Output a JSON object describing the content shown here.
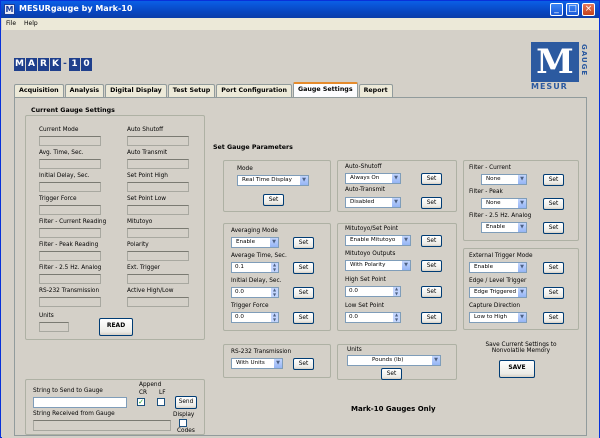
{
  "window": {
    "title": "MESURgauge by Mark-10",
    "icon": "M",
    "min": "_",
    "max": "□",
    "close": "×"
  },
  "menu": [
    "File",
    "Help"
  ],
  "logo": {
    "letters": [
      "M",
      "A",
      "R",
      "K",
      "-",
      "1",
      "0"
    ],
    "mesur_letter": "M",
    "mesur_text": "MESUR",
    "gauge_text": "GAUGE"
  },
  "tabs": [
    "Acquisition",
    "Analysis",
    "Digital Display",
    "Test Setup",
    "Port Configuration",
    "Gauge Settings",
    "Report"
  ],
  "current": {
    "title": "Current Gauge Settings",
    "left_labels": [
      "Current Mode",
      "Avg. Time, Sec.",
      "Initial Delay, Sec.",
      "Trigger Force",
      "Filter - Current Reading",
      "Filter - Peak Reading",
      "Filter - 2.5 Hz. Analog",
      "RS-232 Transmission",
      "Units"
    ],
    "right_labels": [
      "Auto Shutoff",
      "Auto Transmit",
      "Set Point High",
      "Set Point Low",
      "Mitutoyo",
      "Polarity",
      "Ext. Trigger",
      "Active High/Low"
    ],
    "read_button": "READ"
  },
  "comm": {
    "send_label": "String to Send to Gauge",
    "append": "Append",
    "cr": "CR",
    "lf": "LF",
    "send_button": "Send",
    "received_label": "String Received from Gauge",
    "display": "Display",
    "codes": "Codes"
  },
  "params": {
    "title": "Set Gauge Parameters",
    "mode_label": "Mode",
    "mode_value": "Real Time Display",
    "averaging_mode_label": "Averaging Mode",
    "averaging_mode_value": "Enable",
    "avg_time_label": "Average Time, Sec.",
    "avg_time_value": "0.1",
    "initial_delay_label": "Initial Delay, Sec.",
    "initial_delay_value": "0.0",
    "trigger_force_label": "Trigger Force",
    "trigger_force_value": "0.0",
    "rs232_label": "RS-232 Transmission",
    "rs232_value": "With Units",
    "auto_shutoff_label": "Auto-Shutoff",
    "auto_shutoff_value": "Always On",
    "auto_transmit_label": "Auto-Transmit",
    "auto_transmit_value": "Disabled",
    "mitutoyo_sp_label": "Mitutoyo/Set Point",
    "mitutoyo_sp_value": "Enable Mitutoyo",
    "mitutoyo_out_label": "Mitutoyo Outputs",
    "mitutoyo_out_value": "With Polarity",
    "high_sp_label": "High Set Point",
    "high_sp_value": "0.0",
    "low_sp_label": "Low Set Point",
    "low_sp_value": "0.0",
    "units_label": "Units",
    "units_value": "Pounds (lb)",
    "filter_current_label": "Filter - Current",
    "filter_current_value": "None",
    "filter_peak_label": "Filter - Peak",
    "filter_peak_value": "None",
    "filter_analog_label": "Filter - 2.5 Hz. Analog",
    "filter_analog_value": "Enable",
    "ext_trigger_label": "External Trigger Mode",
    "ext_trigger_value": "Enable",
    "edge_label": "Edge / Level Trigger",
    "edge_value": "Edge Triggered",
    "capture_label": "Capture Direction",
    "capture_value": "Low to High",
    "save_note": "Save Current Settings to Nonvolatile Memory",
    "save_button": "SAVE",
    "set": "Set",
    "footer": "Mark-10 Gauges Only"
  }
}
